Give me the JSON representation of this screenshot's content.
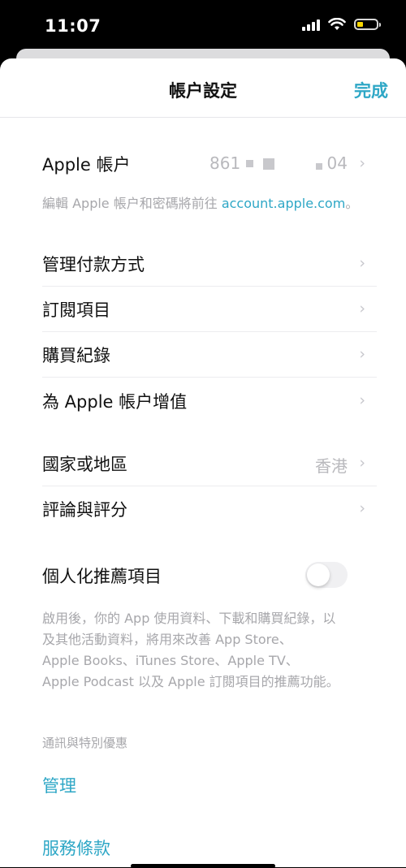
{
  "status_bar": {
    "time": "11:07"
  },
  "nav": {
    "title": "帳户設定",
    "done": "完成"
  },
  "apple_account": {
    "label": "Apple 帳户",
    "value_prefix": "861",
    "value_suffix": "04",
    "caption_text": "編輯 Apple 帳户和密碼將前往 ",
    "caption_link": "account.apple.com",
    "caption_end": "。"
  },
  "menu_group1": [
    {
      "label": "管理付款方式"
    },
    {
      "label": "訂閱項目"
    },
    {
      "label": "購買紀錄"
    },
    {
      "label": "為 Apple 帳户增值"
    }
  ],
  "menu_group2": [
    {
      "label": "國家或地區",
      "value": "香港"
    },
    {
      "label": "評論與評分"
    }
  ],
  "personalization": {
    "label": "個人化推薦項目",
    "toggle_on": false,
    "caption_lines": [
      "啟用後，你的 App 使用資料、下載和購買紀錄，以",
      "及其他活動資料，將用來改善 App Store、",
      "Apple Books、iTunes Store、Apple TV、",
      "Apple Podcast 以及 Apple 訂閱項目的推薦功能。"
    ]
  },
  "promotions": {
    "header": "通訊與特別優惠",
    "manage": "管理"
  },
  "terms": {
    "label": "服務條款"
  },
  "colors": {
    "accent": "#2ea7c6",
    "background": "#ffffff",
    "secondary_text": "#a7a7ab"
  }
}
